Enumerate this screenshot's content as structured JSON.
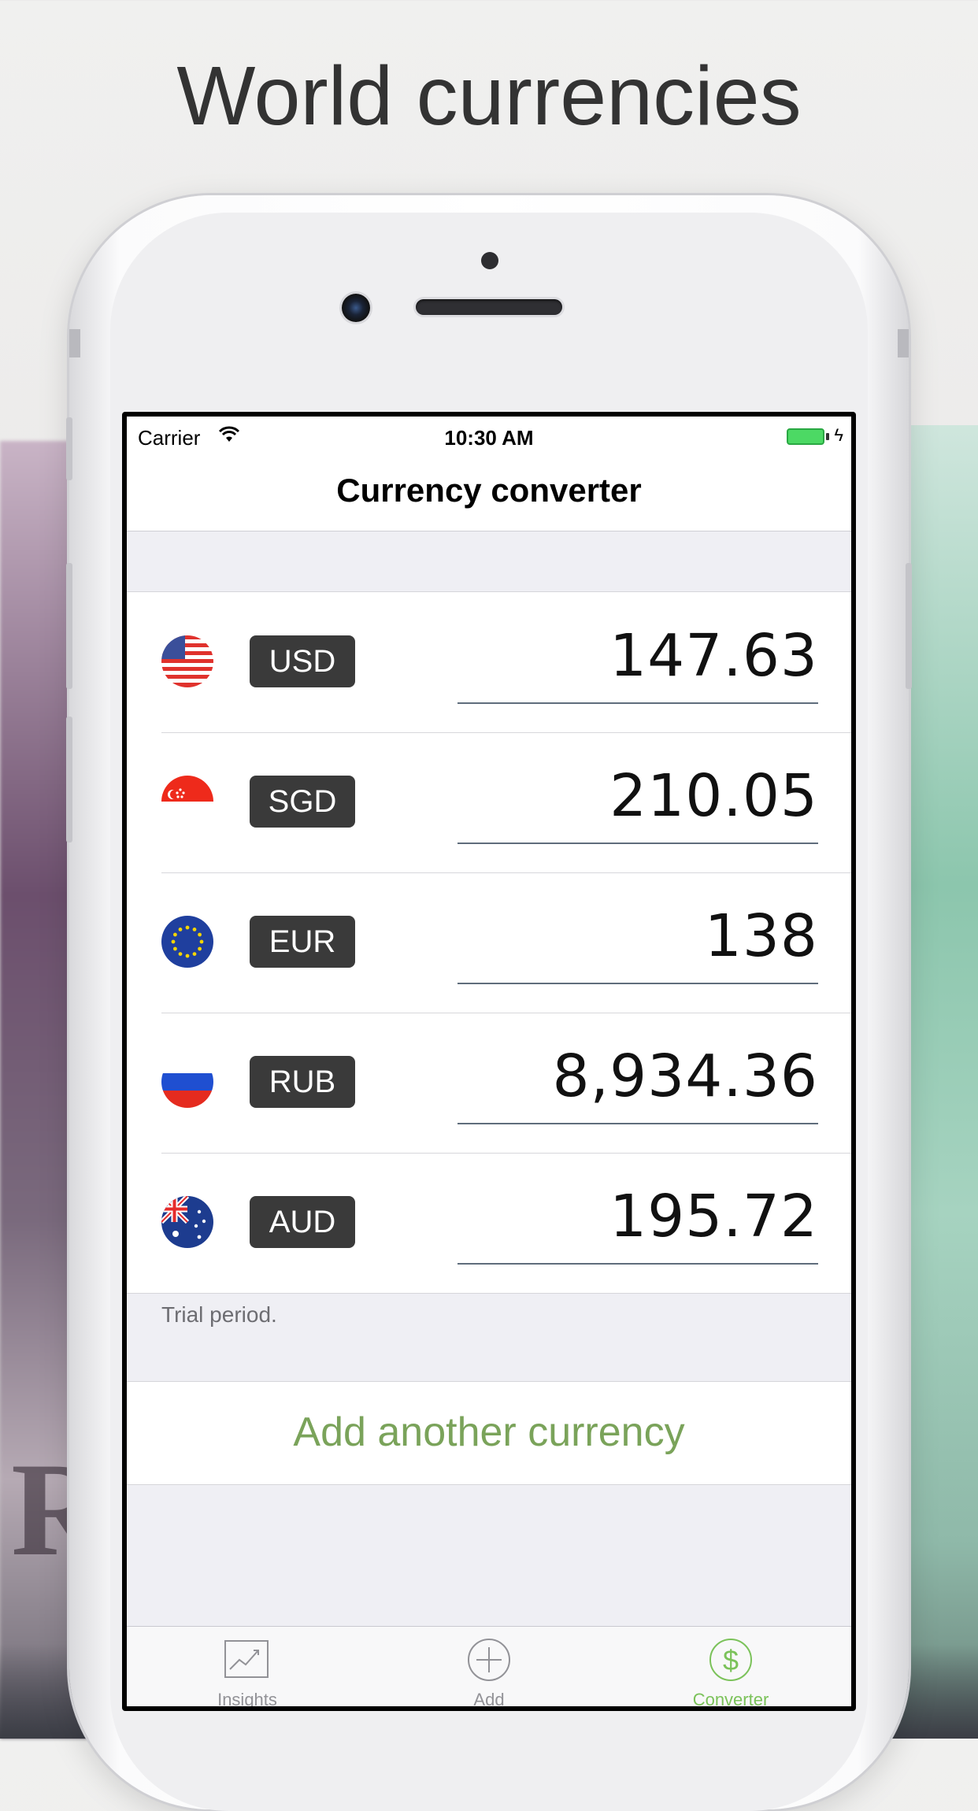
{
  "headline": "World currencies",
  "status_bar": {
    "carrier": "Carrier",
    "time": "10:30 AM",
    "battery_color": "#4cd964"
  },
  "nav": {
    "title": "Currency converter"
  },
  "currencies": [
    {
      "code": "USD",
      "amount": "147.63",
      "flag": "us-flag-icon"
    },
    {
      "code": "SGD",
      "amount": "210.05",
      "flag": "sg-flag-icon"
    },
    {
      "code": "EUR",
      "amount": "138",
      "flag": "eu-flag-icon"
    },
    {
      "code": "RUB",
      "amount": "8,934.36",
      "flag": "ru-flag-icon"
    },
    {
      "code": "AUD",
      "amount": "195.72",
      "flag": "au-flag-icon"
    }
  ],
  "footer_note": "Trial period.",
  "add_button": {
    "label": "Add another currency",
    "color": "#7aa35a"
  },
  "tabs": [
    {
      "label": "Insights",
      "icon": "chart-icon",
      "active": false
    },
    {
      "label": "Add",
      "icon": "plus-circle-icon",
      "active": false
    },
    {
      "label": "Converter",
      "icon": "dollar-circle-icon",
      "active": true
    }
  ],
  "accent_color": "#7bc25a"
}
